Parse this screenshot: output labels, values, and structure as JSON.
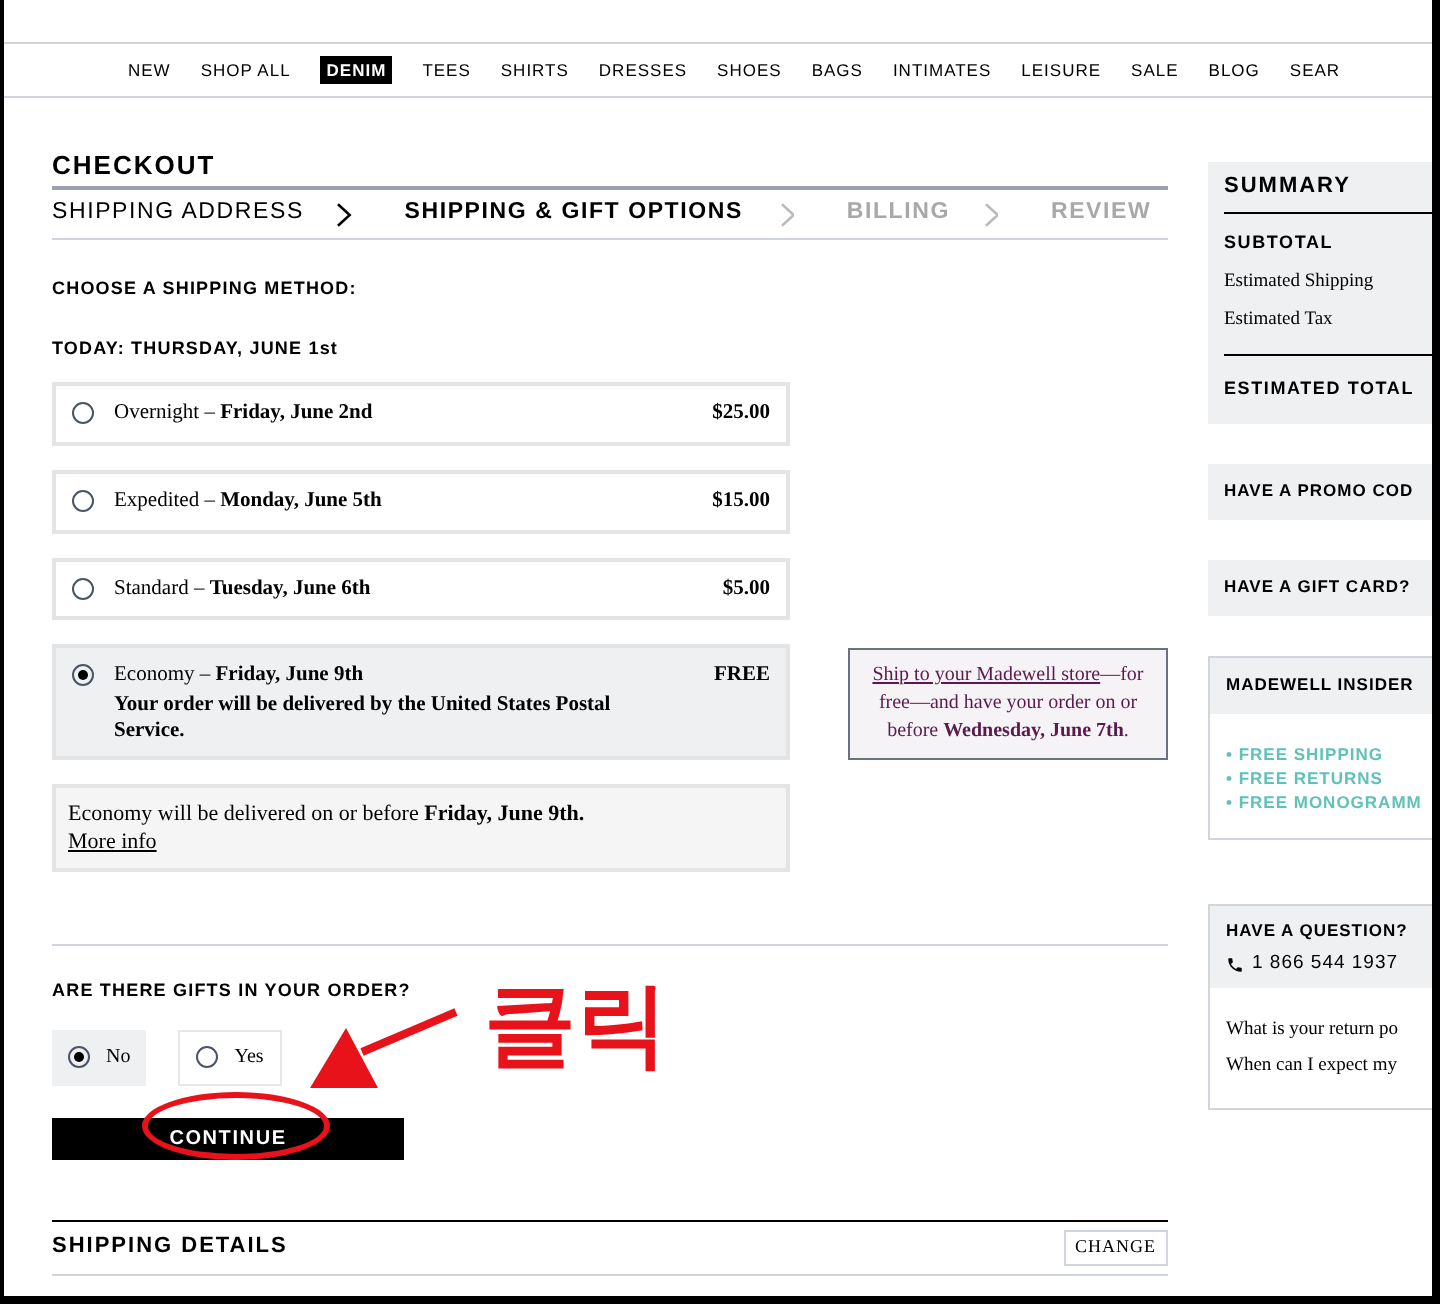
{
  "nav": [
    {
      "label": "NEW",
      "selected": false
    },
    {
      "label": "SHOP ALL",
      "selected": false
    },
    {
      "label": "DENIM",
      "selected": true
    },
    {
      "label": "TEES",
      "selected": false
    },
    {
      "label": "SHIRTS",
      "selected": false
    },
    {
      "label": "DRESSES",
      "selected": false
    },
    {
      "label": "SHOES",
      "selected": false
    },
    {
      "label": "BAGS",
      "selected": false
    },
    {
      "label": "INTIMATES",
      "selected": false
    },
    {
      "label": "LEISURE",
      "selected": false
    },
    {
      "label": "SALE",
      "selected": false
    },
    {
      "label": "BLOG",
      "selected": false
    },
    {
      "label": "SEAR",
      "selected": false
    }
  ],
  "title": "CHECKOUT",
  "steps": [
    {
      "label": "SHIPPING ADDRESS",
      "selected": false,
      "disabled": false
    },
    {
      "label": "SHIPPING & GIFT OPTIONS",
      "selected": true,
      "disabled": false
    },
    {
      "label": "BILLING",
      "selected": false,
      "disabled": true
    },
    {
      "label": "REVIEW",
      "selected": false,
      "disabled": true
    }
  ],
  "shipping": {
    "heading": "CHOOSE A SHIPPING METHOD:",
    "today": "TODAY: THURSDAY, JUNE 1st",
    "methods": [
      {
        "name": "Overnight – **Friday, June 2nd**",
        "price": "$25.00",
        "selected": false
      },
      {
        "name": "Expedited – **Monday, June 5th**",
        "price": "$15.00",
        "selected": false
      },
      {
        "name": "Standard – **Tuesday, June 6th**",
        "price": "$5.00",
        "selected": false
      },
      {
        "name": "Economy – **Friday, June 9th**",
        "note": "Your order will be delivered by the United States Postal Service.",
        "price": "FREE",
        "selected": true
      }
    ],
    "info": {
      "text": "Economy will be delivered on or before **Friday, June 9th.**",
      "link": "More info"
    }
  },
  "store_promo": {
    "link": "Ship to your Madewell store",
    "text": "—for free—and have your order on or before **Wednesday, June 7th**."
  },
  "gifts": {
    "question": "ARE THERE GIFTS IN YOUR ORDER?",
    "options": [
      {
        "label": "No",
        "selected": true
      },
      {
        "label": "Yes",
        "selected": false
      }
    ]
  },
  "continue": "CONTINUE",
  "shipping_details": {
    "title": "SHIPPING DETAILS",
    "action": "CHANGE"
  },
  "summary": {
    "title": "SUMMARY",
    "rows": [
      "SUBTOTAL",
      "Estimated Shipping",
      "Estimated Tax"
    ],
    "total": "ESTIMATED TOTAL"
  },
  "promo": "HAVE A PROMO COD",
  "gift_card": "HAVE A GIFT CARD?",
  "insider": {
    "title": "MADEWELL INSIDER",
    "perks": [
      "• FREE SHIPPING",
      "• FREE RETURNS",
      "• FREE MONOGRAMM"
    ]
  },
  "question": {
    "title": "HAVE A QUESTION?",
    "phone": "1 866 544 1937",
    "faqs": [
      "What is your return po",
      "When can I expect my"
    ]
  },
  "annotation": {
    "text": "클릭"
  }
}
